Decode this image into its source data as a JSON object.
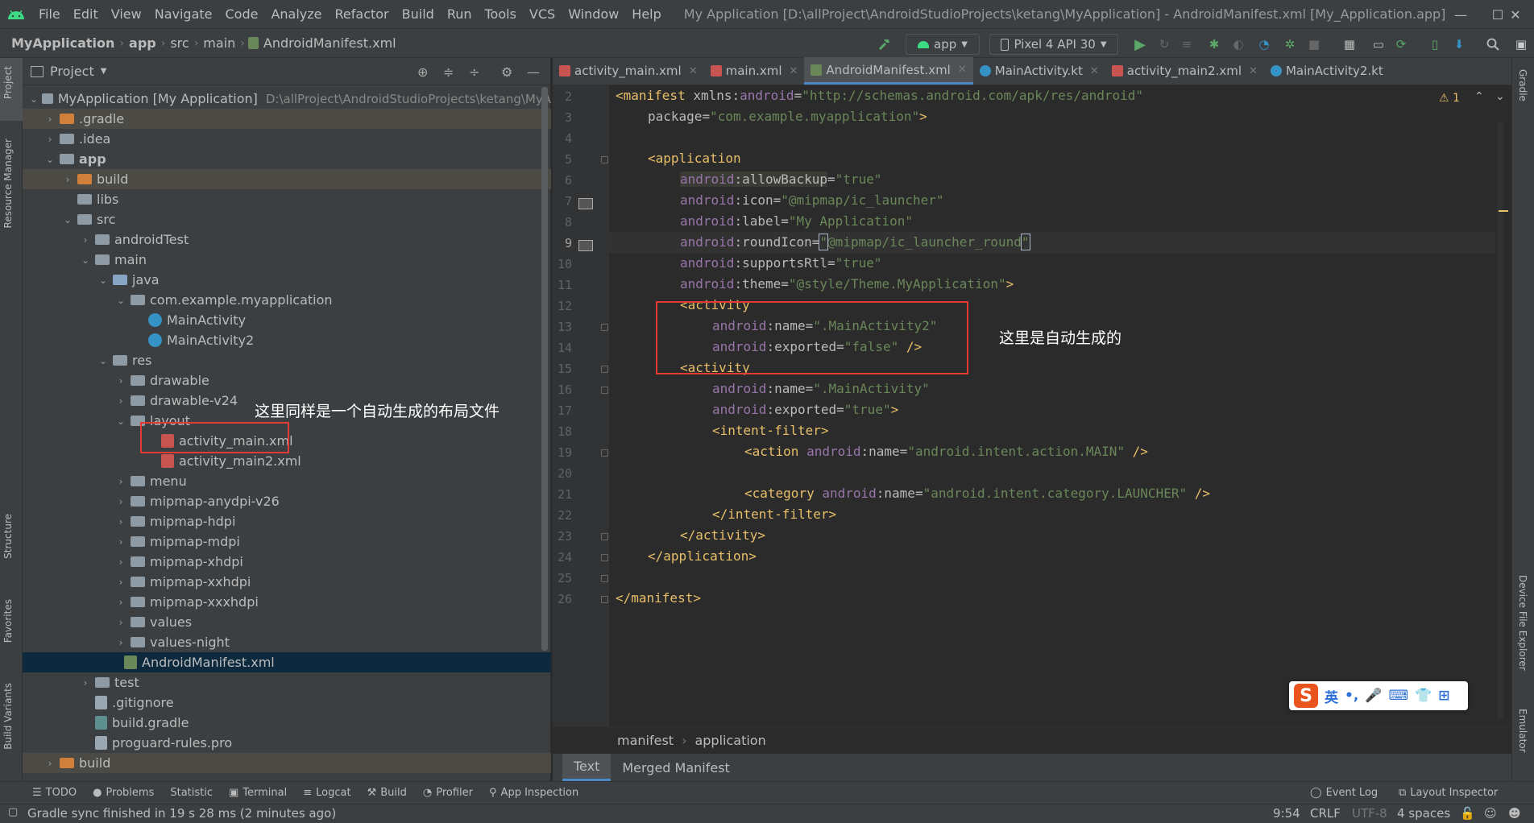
{
  "menubar": {
    "items": [
      "File",
      "Edit",
      "View",
      "Navigate",
      "Code",
      "Analyze",
      "Refactor",
      "Build",
      "Run",
      "Tools",
      "VCS",
      "Window",
      "Help"
    ],
    "title": "My Application [D:\\allProject\\AndroidStudioProjects\\ketang\\MyApplication] - AndroidManifest.xml [My_Application.app]",
    "minimize": "—",
    "maximize": "☐",
    "close": "✕"
  },
  "navbar": {
    "crumbs": [
      "MyApplication",
      "app",
      "src",
      "main",
      "AndroidManifest.xml"
    ],
    "run_config": "app",
    "device": "Pixel 4 API 30"
  },
  "side_tabs": {
    "left": [
      "Project",
      "Resource Manager",
      "Structure",
      "Favorites",
      "Build Variants"
    ],
    "right": [
      "Gradle",
      "Device File Explorer",
      "Emulator"
    ]
  },
  "project": {
    "header": "Project",
    "root_name": "MyApplication [My Application]",
    "root_path": "D:\\allProject\\AndroidStudioProjects\\ketang\\MyA",
    "tree": [
      ".gradle",
      ".idea",
      "app",
      "build",
      "libs",
      "src",
      "androidTest",
      "main",
      "java",
      "com.example.myapplication",
      "MainActivity",
      "MainActivity2",
      "res",
      "drawable",
      "drawable-v24",
      "layout",
      "activity_main.xml",
      "activity_main2.xml",
      "menu",
      "mipmap-anydpi-v26",
      "mipmap-hdpi",
      "mipmap-mdpi",
      "mipmap-xhdpi",
      "mipmap-xxhdpi",
      "mipmap-xxxhdpi",
      "values",
      "values-night",
      "AndroidManifest.xml",
      "test",
      ".gitignore",
      "build.gradle",
      "proguard-rules.pro",
      "build"
    ]
  },
  "annotations": {
    "left": "这里同样是一个自动生成的布局文件",
    "right": "这里是自动生成的"
  },
  "editor": {
    "tabs": [
      "activity_main.xml",
      "main.xml",
      "AndroidManifest.xml",
      "MainActivity.kt",
      "activity_main2.xml",
      "MainActivity2.kt"
    ],
    "active_tab": "AndroidManifest.xml",
    "warning_count": "⚠ 1",
    "line_numbers": [
      "2",
      "3",
      "4",
      "5",
      "6",
      "7",
      "8",
      "9",
      "10",
      "11",
      "12",
      "13",
      "14",
      "15",
      "16",
      "17",
      "18",
      "19",
      "20",
      "21",
      "22",
      "23",
      "24",
      "25",
      "26"
    ],
    "code": {
      "l2": [
        "<manifest ",
        "xmlns:",
        "android",
        "=",
        "\"http://schemas.android.com/apk/res/android\""
      ],
      "l3": [
        "package",
        "=",
        "\"com.example.myapplication\"",
        ">"
      ],
      "l5": "<application",
      "l6": [
        "android",
        ":allowBackup",
        "=",
        "\"true\""
      ],
      "l7": [
        "android",
        ":icon",
        "=",
        "\"@mipmap/ic_launcher\""
      ],
      "l8": [
        "android",
        ":label",
        "=",
        "\"My Application\""
      ],
      "l9": [
        "android",
        ":roundIcon",
        "=",
        "\"",
        "@mipmap/ic_launcher_round",
        "\""
      ],
      "l10": [
        "android",
        ":supportsRtl",
        "=",
        "\"true\""
      ],
      "l11": [
        "android",
        ":theme",
        "=",
        "\"@style/Theme.MyApplication\"",
        ">"
      ],
      "l12": "<activity",
      "l13": [
        "android",
        ":name",
        "=",
        "\".MainActivity2\""
      ],
      "l14": [
        "android",
        ":exported",
        "=",
        "\"false\"",
        " />"
      ],
      "l15": "<activity",
      "l16": [
        "android",
        ":name",
        "=",
        "\".MainActivity\""
      ],
      "l17": [
        "android",
        ":exported",
        "=",
        "\"true\"",
        ">"
      ],
      "l18": "<intent-filter>",
      "l19": [
        "<action ",
        "android",
        ":name",
        "=",
        "\"android.intent.action.MAIN\"",
        " />"
      ],
      "l21": [
        "<category ",
        "android",
        ":name",
        "=",
        "\"android.intent.category.LAUNCHER\"",
        " />"
      ],
      "l22": "</intent-filter>",
      "l23": "</activity>",
      "l24": "</application>",
      "l26": "</manifest>"
    },
    "breadcrumb": [
      "manifest",
      "application"
    ],
    "bottom_tabs": [
      "Text",
      "Merged Manifest"
    ]
  },
  "toolwindows": [
    "TODO",
    "Problems",
    "Statistic",
    "Terminal",
    "Logcat",
    "Build",
    "Profiler",
    "App Inspection"
  ],
  "toolwindows_right": [
    "Event Log",
    "Layout Inspector"
  ],
  "status": {
    "message": "Gradle sync finished in 19 s 28 ms (2 minutes ago)",
    "position": "9:54",
    "line_sep": "CRLF",
    "encoding": "UTF-8",
    "indent": "4 spaces"
  },
  "ime": {
    "logo": "S",
    "lang": "英",
    "punct": "•,"
  },
  "colors": {
    "tag": "#e8bf6a",
    "namespace": "#9876aa",
    "attr": "#bababa",
    "value": "#6a8759",
    "annotation_border": "#e53935",
    "selection": "#0d293e"
  }
}
